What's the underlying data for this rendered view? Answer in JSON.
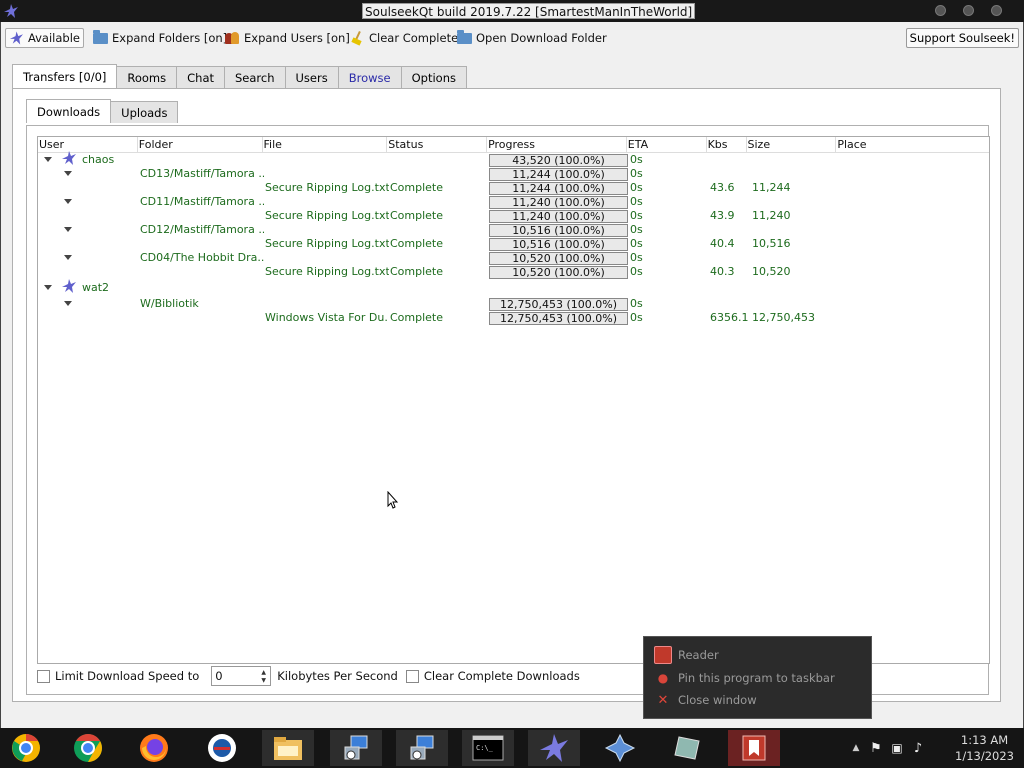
{
  "window": {
    "title": "SoulseekQt build 2019.7.22 [SmartestManInTheWorld]"
  },
  "toolbar": {
    "available": "Available",
    "expand_folders": "Expand Folders [on]",
    "expand_users": "Expand Users [on]",
    "clear_complete": "Clear Complete",
    "open_folder": "Open Download Folder",
    "support": "Support Soulseek!"
  },
  "tabs": [
    "Transfers [0/0]",
    "Rooms",
    "Chat",
    "Search",
    "Users",
    "Browse",
    "Options"
  ],
  "subtabs": [
    "Downloads",
    "Uploads"
  ],
  "columns": [
    "User",
    "Folder",
    "File",
    "Status",
    "Progress",
    "ETA",
    "Kbs",
    "Size",
    "Place"
  ],
  "rows": [
    {
      "user": "chaos",
      "folder": "",
      "file": "",
      "status": "",
      "progress": "43,520 (100.0%)",
      "eta": "0s",
      "kbs": "",
      "size": ""
    },
    {
      "user": "",
      "folder": "CD13/Mastiff/Tamora ...",
      "file": "",
      "status": "",
      "progress": "11,244 (100.0%)",
      "eta": "0s",
      "kbs": "",
      "size": ""
    },
    {
      "user": "",
      "folder": "",
      "file": "Secure Ripping Log.txt",
      "status": "Complete",
      "progress": "11,244 (100.0%)",
      "eta": "0s",
      "kbs": "43.6",
      "size": "11,244"
    },
    {
      "user": "",
      "folder": "CD11/Mastiff/Tamora ...",
      "file": "",
      "status": "",
      "progress": "11,240 (100.0%)",
      "eta": "0s",
      "kbs": "",
      "size": ""
    },
    {
      "user": "",
      "folder": "",
      "file": "Secure Ripping Log.txt",
      "status": "Complete",
      "progress": "11,240 (100.0%)",
      "eta": "0s",
      "kbs": "43.9",
      "size": "11,240"
    },
    {
      "user": "",
      "folder": "CD12/Mastiff/Tamora ...",
      "file": "",
      "status": "",
      "progress": "10,516 (100.0%)",
      "eta": "0s",
      "kbs": "",
      "size": ""
    },
    {
      "user": "",
      "folder": "",
      "file": "Secure Ripping Log.txt",
      "status": "Complete",
      "progress": "10,516 (100.0%)",
      "eta": "0s",
      "kbs": "40.4",
      "size": "10,516"
    },
    {
      "user": "",
      "folder": "CD04/The Hobbit Dra...",
      "file": "",
      "status": "",
      "progress": "10,520 (100.0%)",
      "eta": "0s",
      "kbs": "",
      "size": ""
    },
    {
      "user": "",
      "folder": "",
      "file": "Secure Ripping Log.txt",
      "status": "Complete",
      "progress": "10,520 (100.0%)",
      "eta": "0s",
      "kbs": "40.3",
      "size": "10,520"
    },
    {
      "user": "wat2",
      "folder": "",
      "file": "",
      "status": "",
      "progress": "",
      "eta": "",
      "kbs": "",
      "size": ""
    },
    {
      "user": "",
      "folder": "W/Bibliotik",
      "file": "",
      "status": "",
      "progress": "12,750,453 (100.0%)",
      "eta": "0s",
      "kbs": "",
      "size": ""
    },
    {
      "user": "",
      "folder": "",
      "file": "Windows Vista For Du...",
      "status": "Complete",
      "progress": "12,750,453 (100.0%)",
      "eta": "0s",
      "kbs": "6356.1",
      "size": "12,750,453"
    }
  ],
  "bottom": {
    "limit_label": "Limit Download Speed to",
    "speed_value": "0",
    "unit": "Kilobytes Per Second",
    "clear_label": "Clear Complete Downloads"
  },
  "popup": {
    "items": [
      "Reader",
      "Pin this program to taskbar",
      "Close window"
    ]
  },
  "clock": {
    "time": "1:13 AM",
    "date": "1/13/2023"
  }
}
